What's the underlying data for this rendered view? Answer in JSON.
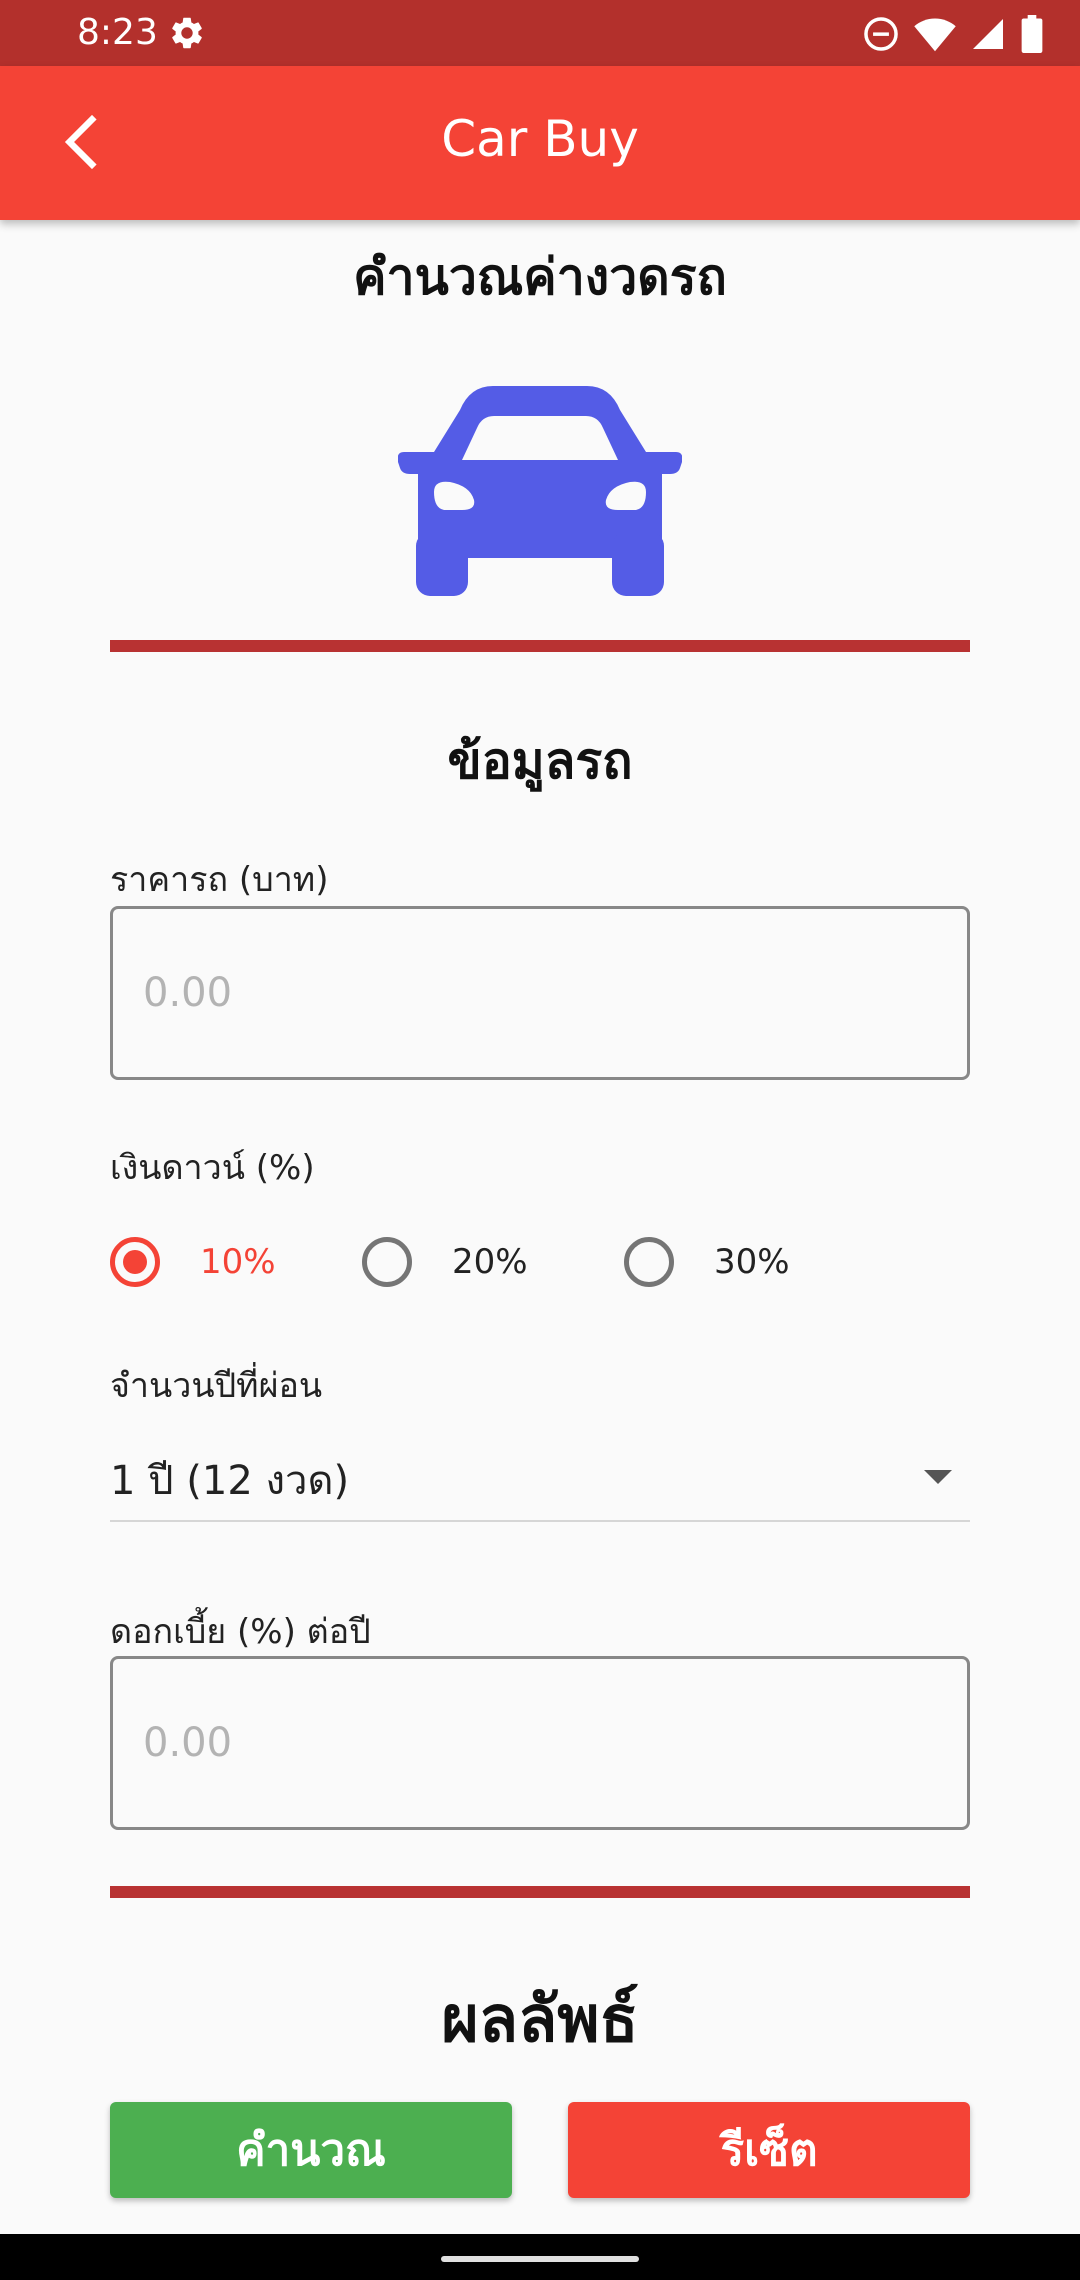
{
  "status_bar": {
    "time": "8:23",
    "icons": [
      "settings-icon",
      "do-not-disturb-icon",
      "wifi-icon",
      "cell-signal-icon",
      "battery-icon"
    ]
  },
  "app_bar": {
    "title": "Car Buy",
    "back_icon": "chevron-left-icon"
  },
  "page": {
    "title": "คำนวณค่างวดรถ",
    "car_icon": "car-icon",
    "car_icon_color": "#545ce6"
  },
  "form": {
    "section_title": "ข้อมูลรถ",
    "price": {
      "label": "ราคารถ (บาท)",
      "placeholder": "0.00",
      "value": ""
    },
    "down_payment": {
      "label": "เงินดาวน์ (%)",
      "options": [
        "10%",
        "20%",
        "30%"
      ],
      "selected": "10%"
    },
    "years": {
      "label": "จำนวนปีที่ผ่อน",
      "selected": "1 ปี (12 งวด)"
    },
    "interest": {
      "label": "ดอกเบี้ย (%) ต่อปี",
      "placeholder": "0.00",
      "value": ""
    }
  },
  "result": {
    "title": "ผลลัพธ์"
  },
  "buttons": {
    "calculate": "คำนวณ",
    "reset": "รีเซ็ต"
  },
  "colors": {
    "accent": "#f44336",
    "status_bar": "#b3302c",
    "divider": "#b83232",
    "calculate_button": "#4caf50",
    "reset_button": "#f44336"
  }
}
